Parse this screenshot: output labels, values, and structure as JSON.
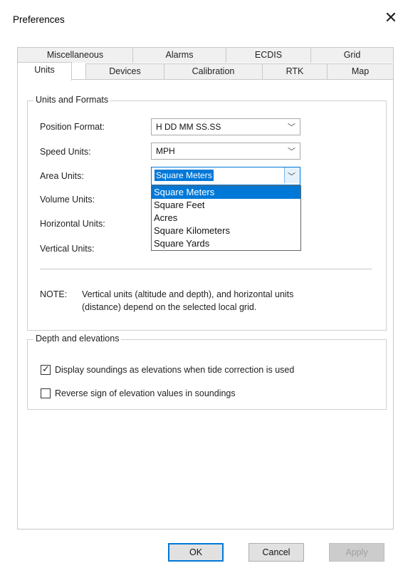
{
  "window": {
    "title": "Preferences",
    "close_glyph": "✕"
  },
  "tabs": {
    "row_back": [
      "Miscellaneous",
      "Alarms",
      "ECDIS",
      "Grid"
    ],
    "row_front": [
      "Units",
      "Devices",
      "Calibration",
      "RTK",
      "Map"
    ],
    "active": "Units"
  },
  "units_group": {
    "title": "Units and Formats",
    "fields": [
      {
        "label": "Position Format:",
        "value": "H DD MM SS.SS"
      },
      {
        "label": "Speed Units:",
        "value": "MPH"
      },
      {
        "label": "Area Units:",
        "value": "Square Meters"
      },
      {
        "label": "Volume Units:",
        "value": ""
      },
      {
        "label": "Horizontal Units:",
        "value": ""
      },
      {
        "label": "Vertical Units:",
        "value": ""
      }
    ],
    "area_dropdown": {
      "options": [
        "Square Meters",
        "Square Feet",
        "Acres",
        "Square Kilometers",
        "Square Yards"
      ],
      "selected": "Square Meters"
    },
    "note_label": "NOTE:",
    "note_line1": "Vertical units (altitude and depth), and horizontal units",
    "note_line2": "(distance) depend on the selected local grid."
  },
  "depth_group": {
    "title": "Depth and elevations",
    "options": [
      {
        "label": "Display soundings as elevations when tide correction is used",
        "checked": true
      },
      {
        "label": "Reverse sign of elevation values in soundings",
        "checked": false
      }
    ]
  },
  "buttons": {
    "ok": "OK",
    "cancel": "Cancel",
    "apply": "Apply"
  },
  "icons": {
    "combo_arrow": "chevron-down-icon",
    "check": "checkmark-icon"
  },
  "colors": {
    "accent": "#0078d7",
    "disabled_button": "#cccccc"
  }
}
